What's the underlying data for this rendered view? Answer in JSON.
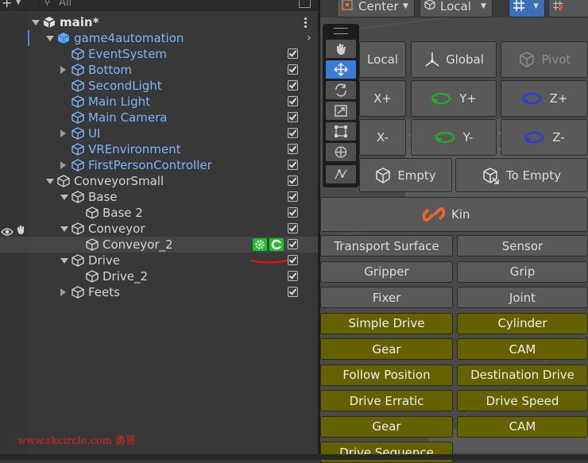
{
  "hierarchy": {
    "search_placeholder": "All",
    "rows": [
      {
        "label": "main*",
        "color": "white",
        "indent": 0,
        "arrow": "down",
        "scene": true
      },
      {
        "label": "game4automation",
        "color": "blue",
        "indent": 1,
        "arrow": "down",
        "prefab": true
      },
      {
        "label": "EventSystem",
        "color": "blue",
        "indent": 2,
        "arrow": "none"
      },
      {
        "label": "Bottom",
        "color": "blue",
        "indent": 2,
        "arrow": "right"
      },
      {
        "label": "SecondLight",
        "color": "blue",
        "indent": 2,
        "arrow": "none"
      },
      {
        "label": "Main Light",
        "color": "blue",
        "indent": 2,
        "arrow": "none"
      },
      {
        "label": "Main Camera",
        "color": "blue",
        "indent": 2,
        "arrow": "none"
      },
      {
        "label": "UI",
        "color": "blue",
        "indent": 2,
        "arrow": "right"
      },
      {
        "label": "VREnvironment",
        "color": "blue",
        "indent": 2,
        "arrow": "none"
      },
      {
        "label": "FirstPersonController",
        "color": "blue",
        "indent": 2,
        "arrow": "right"
      },
      {
        "label": "ConveyorSmall",
        "color": "white",
        "indent": 1,
        "arrow": "down"
      },
      {
        "label": "Base",
        "color": "white",
        "indent": 2,
        "arrow": "down"
      },
      {
        "label": "Base 2",
        "color": "white",
        "indent": 3,
        "arrow": "none"
      },
      {
        "label": "Conveyor",
        "color": "white",
        "indent": 2,
        "arrow": "down"
      },
      {
        "label": "Conveyor_2",
        "color": "white",
        "indent": 3,
        "arrow": "none",
        "selected": true
      },
      {
        "label": "Drive",
        "color": "white",
        "indent": 2,
        "arrow": "down"
      },
      {
        "label": "Drive_2",
        "color": "white",
        "indent": 3,
        "arrow": "none"
      },
      {
        "label": "Feets",
        "color": "white",
        "indent": 2,
        "arrow": "right"
      }
    ]
  },
  "scene_toolbar": {
    "pivot_mode": "Center",
    "pivot_rotation": "Local"
  },
  "quick_edit": {
    "row1": [
      "Local",
      "Global",
      "Pivot"
    ],
    "row2": [
      "X+",
      "Y+",
      "Z+"
    ],
    "row3": [
      "X-",
      "Y-",
      "Z-"
    ],
    "row4": [
      "Empty",
      "To Empty"
    ],
    "kin": "Kin",
    "grid_gray": [
      [
        "Transport Surface",
        "Sensor"
      ],
      [
        "Gripper",
        "Grip"
      ],
      [
        "Fixer",
        "Joint"
      ]
    ],
    "grid_olive": [
      [
        "Simple Drive",
        "Cylinder"
      ],
      [
        "Gear",
        "CAM"
      ],
      [
        "Follow Position",
        "Destination Drive"
      ],
      [
        "Drive Erratic",
        "Drive Speed"
      ],
      [
        "Gear",
        "CAM"
      ],
      [
        "Drive Sequence",
        ""
      ]
    ]
  },
  "colors": {
    "accent": "#3b7bd4",
    "olive": "#636100",
    "green_icon": "#1fbf2a"
  },
  "watermark": "www.skcircle.com 勇哥"
}
